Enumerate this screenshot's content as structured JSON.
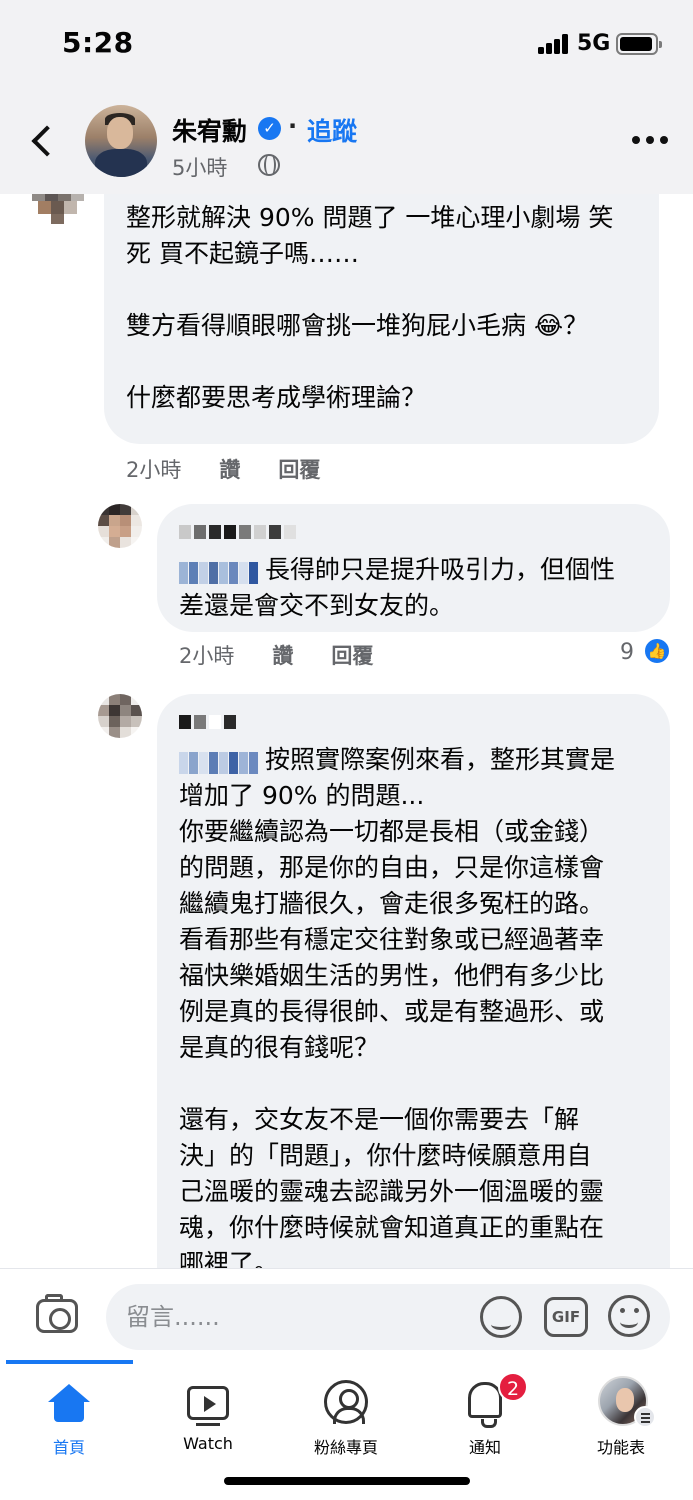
{
  "status_bar": {
    "time": "5:28",
    "network": "5G"
  },
  "post_header": {
    "author": "朱宥勳",
    "separator": "·",
    "follow_label": "追蹤",
    "time": "5小時"
  },
  "comments": [
    {
      "text": "整形就解決 90% 問題了 一堆心理小劇場 笑\n死 買不起鏡子嗎……\n\n雙方看得順眼哪會挑一堆狗屁小毛病 😂？\n\n什麼都要思考成學術理論？",
      "time": "2小時",
      "like_label": "讚",
      "reply_label": "回覆"
    },
    {
      "text": "長得帥只是提升吸引力，但個性\n差還是會交不到女友的。",
      "time": "2小時",
      "like_label": "讚",
      "reply_label": "回覆",
      "reactions": "9"
    },
    {
      "text": "按照實際案例來看，整形其實是\n增加了 90% 的問題...\n你要繼續認為一切都是長相（或金錢）\n的問題，那是你的自由，只是你這樣會\n繼續鬼打牆很久，會走很多冤枉的路。\n看看那些有穩定交往對象或已經過著幸\n福快樂婚姻生活的男性，他們有多少比\n例是真的長得很帥、或是有整過形、或\n是真的很有錢呢？\n\n還有，交女友不是一個你需要去「解\n決」的「問題」，你什麼時候願意用自\n己溫暖的靈魂去認識另外一個溫暖的靈\n魂，你什麼時候就會知道真正的重點在\n哪裡了。"
    }
  ],
  "composer": {
    "placeholder": "留言......",
    "gif_label": "GIF"
  },
  "tabs": [
    {
      "label": "首頁"
    },
    {
      "label": "Watch"
    },
    {
      "label": "粉絲專頁"
    },
    {
      "label": "通知",
      "badge": "2"
    },
    {
      "label": "功能表"
    }
  ],
  "colors": {
    "accent": "#1877f2",
    "bubble": "#f0f2f5",
    "badge": "#e41e3f",
    "secondary_text": "#65676b"
  },
  "icons": [
    "back-arrow-icon",
    "verified-badge-icon",
    "globe-icon",
    "more-options-icon",
    "laugh-cry-emoji",
    "like-reaction-icon",
    "camera-icon",
    "sticker-icon",
    "gif-icon",
    "emoji-icon",
    "home-icon",
    "watch-icon",
    "pages-icon",
    "bell-icon",
    "profile-menu-avatar"
  ]
}
